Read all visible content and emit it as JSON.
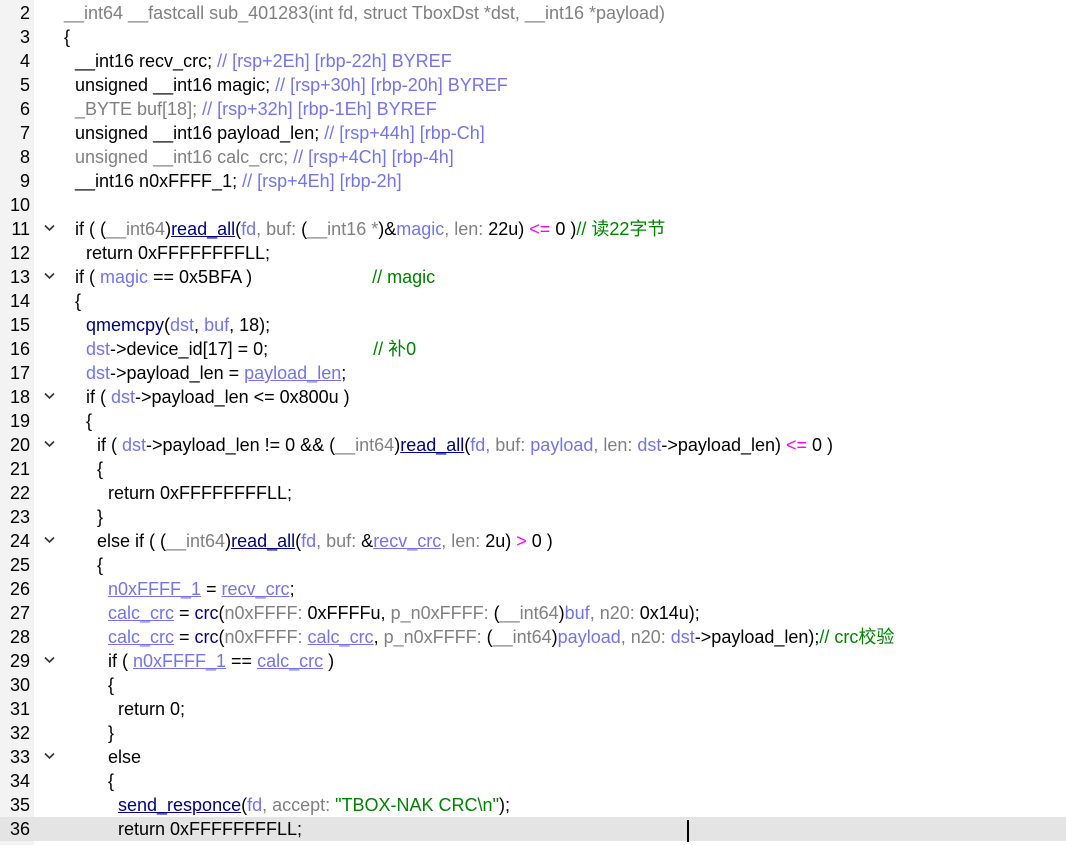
{
  "editor": {
    "lines": [
      {
        "num": "2",
        "indent": 1,
        "fold": false,
        "tokens": [
          [
            "g",
            "__int64 __fastcall sub_401283(int fd, struct TboxDst *dst, __int16 *payload)"
          ]
        ]
      },
      {
        "num": "3",
        "indent": 1,
        "fold": false,
        "tokens": [
          [
            "k",
            "{"
          ]
        ]
      },
      {
        "num": "4",
        "indent": 2,
        "fold": false,
        "tokens": [
          [
            "k",
            "__int16 recv_crc; "
          ],
          [
            "v",
            "// [rsp+2Eh] [rbp-22h] BYREF"
          ]
        ]
      },
      {
        "num": "5",
        "indent": 2,
        "fold": false,
        "tokens": [
          [
            "k",
            "unsigned __int16 magic; "
          ],
          [
            "v",
            "// [rsp+30h] [rbp-20h] BYREF"
          ]
        ]
      },
      {
        "num": "6",
        "indent": 2,
        "fold": false,
        "tokens": [
          [
            "g",
            "_BYTE buf[18]; "
          ],
          [
            "v",
            "// [rsp+32h] [rbp-1Eh] BYREF"
          ]
        ]
      },
      {
        "num": "7",
        "indent": 2,
        "fold": false,
        "tokens": [
          [
            "k",
            "unsigned __int16 payload_len; "
          ],
          [
            "v",
            "// [rsp+44h] [rbp-Ch]"
          ]
        ]
      },
      {
        "num": "8",
        "indent": 2,
        "fold": false,
        "tokens": [
          [
            "g",
            "unsigned __int16 calc_crc; "
          ],
          [
            "v",
            "// [rsp+4Ch] [rbp-4h]"
          ]
        ]
      },
      {
        "num": "9",
        "indent": 2,
        "fold": false,
        "tokens": [
          [
            "k",
            "__int16 n0xFFFF_1; "
          ],
          [
            "v",
            "// [rsp+4Eh] [rbp-2h]"
          ]
        ]
      },
      {
        "num": "10",
        "indent": 0,
        "fold": false,
        "tokens": []
      },
      {
        "num": "11",
        "indent": 2,
        "fold": true,
        "tokens": [
          [
            "k",
            "if ( ("
          ],
          [
            "g",
            "__int64"
          ],
          [
            "k",
            ")"
          ],
          [
            "f",
            "read_all"
          ],
          [
            "k",
            "("
          ],
          [
            "v",
            "fd"
          ],
          [
            "g",
            ", buf: "
          ],
          [
            "k",
            "("
          ],
          [
            "g",
            "__int16 *"
          ],
          [
            "k",
            ")&"
          ],
          [
            "v",
            "magic"
          ],
          [
            "g",
            ", len: "
          ],
          [
            "k",
            "22u) "
          ],
          [
            "o",
            "<="
          ],
          [
            "k",
            " 0 )"
          ],
          [
            "c",
            "// 读22字节"
          ]
        ]
      },
      {
        "num": "12",
        "indent": 3,
        "fold": false,
        "tokens": [
          [
            "k",
            "return 0xFFFFFFFFLL;"
          ]
        ]
      },
      {
        "num": "13",
        "indent": 2,
        "fold": true,
        "tokens": [
          [
            "k",
            "if ( "
          ],
          [
            "v",
            "magic"
          ],
          [
            "k",
            " == 0x5BFA )                        "
          ],
          [
            "c",
            "// magic"
          ]
        ]
      },
      {
        "num": "14",
        "indent": 2,
        "fold": false,
        "tokens": [
          [
            "k",
            "{"
          ]
        ]
      },
      {
        "num": "15",
        "indent": 3,
        "fold": false,
        "tokens": [
          [
            "f",
            "qmemcpy"
          ],
          [
            "k",
            "("
          ],
          [
            "v",
            "dst"
          ],
          [
            "k",
            ", "
          ],
          [
            "v",
            "buf"
          ],
          [
            "k",
            ", 18);"
          ]
        ]
      },
      {
        "num": "16",
        "indent": 3,
        "fold": false,
        "tokens": [
          [
            "v",
            "dst"
          ],
          [
            "k",
            "->device_id[17] = 0;                     "
          ],
          [
            "c",
            "// 补0"
          ]
        ]
      },
      {
        "num": "17",
        "indent": 3,
        "fold": false,
        "tokens": [
          [
            "v",
            "dst"
          ],
          [
            "k",
            "->payload_len = "
          ],
          [
            "v",
            "payload_len"
          ],
          [
            "k",
            ";"
          ]
        ]
      },
      {
        "num": "18",
        "indent": 3,
        "fold": true,
        "tokens": [
          [
            "k",
            "if ( "
          ],
          [
            "v",
            "dst"
          ],
          [
            "k",
            "->payload_len <= 0x800u )"
          ]
        ]
      },
      {
        "num": "19",
        "indent": 3,
        "fold": false,
        "tokens": [
          [
            "k",
            "{"
          ]
        ]
      },
      {
        "num": "20",
        "indent": 4,
        "fold": true,
        "tokens": [
          [
            "k",
            "if ( "
          ],
          [
            "v",
            "dst"
          ],
          [
            "k",
            "->payload_len != 0 && ("
          ],
          [
            "g",
            "__int64"
          ],
          [
            "k",
            ")"
          ],
          [
            "f",
            "read_all"
          ],
          [
            "k",
            "("
          ],
          [
            "v",
            "fd"
          ],
          [
            "g",
            ", buf: "
          ],
          [
            "v",
            "payload"
          ],
          [
            "g",
            ", len: "
          ],
          [
            "v",
            "dst"
          ],
          [
            "k",
            "->payload_len) "
          ],
          [
            "o",
            "<="
          ],
          [
            "k",
            " 0 )"
          ]
        ]
      },
      {
        "num": "21",
        "indent": 4,
        "fold": false,
        "tokens": [
          [
            "k",
            "{"
          ]
        ]
      },
      {
        "num": "22",
        "indent": 5,
        "fold": false,
        "tokens": [
          [
            "k",
            "return 0xFFFFFFFFLL;"
          ]
        ]
      },
      {
        "num": "23",
        "indent": 4,
        "fold": false,
        "tokens": [
          [
            "k",
            "}"
          ]
        ]
      },
      {
        "num": "24",
        "indent": 4,
        "fold": true,
        "tokens": [
          [
            "k",
            "else if ( ("
          ],
          [
            "g",
            "__int64"
          ],
          [
            "k",
            ")"
          ],
          [
            "f",
            "read_all"
          ],
          [
            "k",
            "("
          ],
          [
            "v",
            "fd"
          ],
          [
            "g",
            ", buf: "
          ],
          [
            "k",
            "&"
          ],
          [
            "v",
            "recv_crc"
          ],
          [
            "g",
            ", len: "
          ],
          [
            "k",
            "2u) "
          ],
          [
            "o",
            ">"
          ],
          [
            "k",
            " 0 )"
          ]
        ]
      },
      {
        "num": "25",
        "indent": 4,
        "fold": false,
        "tokens": [
          [
            "k",
            "{"
          ]
        ]
      },
      {
        "num": "26",
        "indent": 5,
        "fold": false,
        "tokens": [
          [
            "v",
            "n0xFFFF_1"
          ],
          [
            "k",
            " = "
          ],
          [
            "v",
            "recv_crc"
          ],
          [
            "k",
            ";"
          ]
        ]
      },
      {
        "num": "27",
        "indent": 5,
        "fold": false,
        "tokens": [
          [
            "v",
            "calc_crc"
          ],
          [
            "k",
            " = "
          ],
          [
            "f",
            "crc"
          ],
          [
            "k",
            "("
          ],
          [
            "g",
            "n0xFFFF: "
          ],
          [
            "k",
            "0xFFFFu, "
          ],
          [
            "g",
            "p_n0xFFFF: "
          ],
          [
            "k",
            "("
          ],
          [
            "g",
            "__int64"
          ],
          [
            "k",
            ")"
          ],
          [
            "v",
            "buf"
          ],
          [
            "g",
            ", n20: "
          ],
          [
            "k",
            "0x14u);"
          ]
        ]
      },
      {
        "num": "28",
        "indent": 5,
        "fold": false,
        "tokens": [
          [
            "v",
            "calc_crc"
          ],
          [
            "k",
            " = "
          ],
          [
            "f",
            "crc"
          ],
          [
            "k",
            "("
          ],
          [
            "g",
            "n0xFFFF: "
          ],
          [
            "v",
            "calc_crc"
          ],
          [
            "k",
            ", "
          ],
          [
            "g",
            "p_n0xFFFF: "
          ],
          [
            "k",
            "("
          ],
          [
            "g",
            "__int64"
          ],
          [
            "k",
            ")"
          ],
          [
            "v",
            "payload"
          ],
          [
            "g",
            ", n20: "
          ],
          [
            "v",
            "dst"
          ],
          [
            "k",
            "->payload_len);"
          ],
          [
            "c",
            "// crc校验"
          ]
        ]
      },
      {
        "num": "29",
        "indent": 5,
        "fold": true,
        "tokens": [
          [
            "k",
            "if ( "
          ],
          [
            "v",
            "n0xFFFF_1"
          ],
          [
            "k",
            " == "
          ],
          [
            "v",
            "calc_crc"
          ],
          [
            "k",
            " )"
          ]
        ]
      },
      {
        "num": "30",
        "indent": 5,
        "fold": false,
        "tokens": [
          [
            "k",
            "{"
          ]
        ]
      },
      {
        "num": "31",
        "indent": 6,
        "fold": false,
        "tokens": [
          [
            "k",
            "return 0;"
          ]
        ]
      },
      {
        "num": "32",
        "indent": 5,
        "fold": false,
        "tokens": [
          [
            "k",
            "}"
          ]
        ]
      },
      {
        "num": "33",
        "indent": 5,
        "fold": true,
        "tokens": [
          [
            "k",
            "else"
          ]
        ]
      },
      {
        "num": "34",
        "indent": 5,
        "fold": false,
        "tokens": [
          [
            "k",
            "{"
          ]
        ]
      },
      {
        "num": "35",
        "indent": 6,
        "fold": false,
        "tokens": [
          [
            "f",
            "send_responce"
          ],
          [
            "k",
            "("
          ],
          [
            "v",
            "fd"
          ],
          [
            "g",
            ", accept: "
          ],
          [
            "s",
            "\"TBOX-NAK CRC\\n\""
          ],
          [
            "k",
            ");"
          ]
        ]
      },
      {
        "num": "36",
        "indent": 6,
        "fold": false,
        "current": true,
        "tokens": [
          [
            "k",
            "return 0xFFFFFFFFLL;"
          ]
        ]
      }
    ]
  },
  "colors": {
    "keyword": "#000000",
    "function": "#000080",
    "variable": "#7474e8",
    "comment": "#008000",
    "string": "#008000",
    "operator": "#ff00ff",
    "type_gray": "#808080",
    "gutter_bg": "#f3f3f3",
    "current_line_bg": "#e4e4e4"
  },
  "icons": {
    "fold_marker": "chevron-down-icon"
  }
}
